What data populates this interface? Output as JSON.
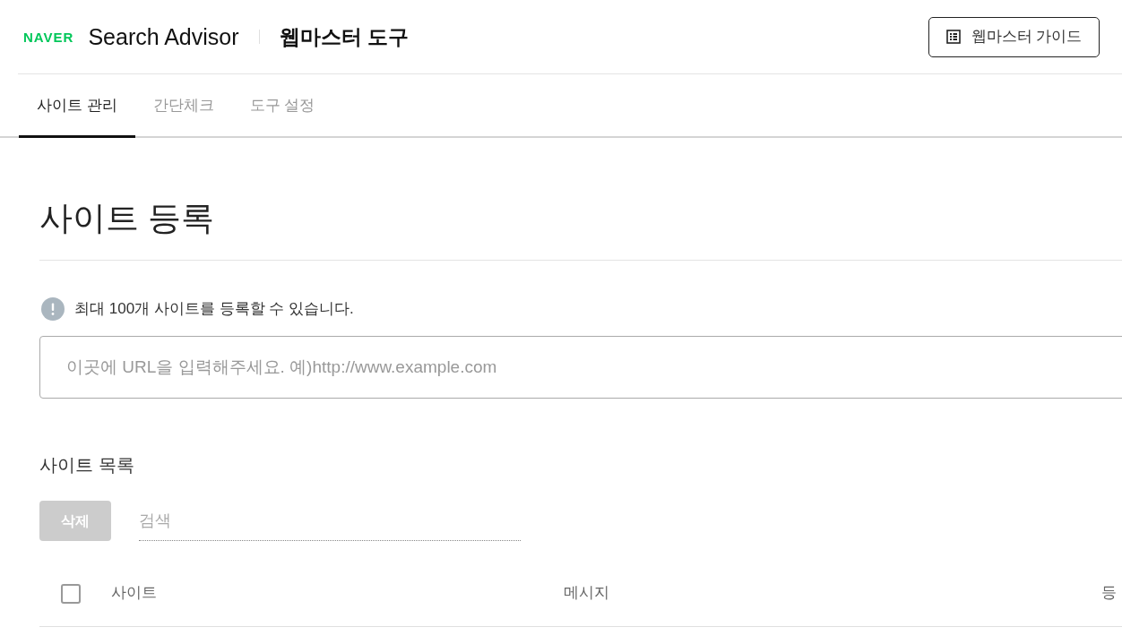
{
  "header": {
    "logo": "NAVER",
    "title": "Search Advisor",
    "subtitle": "웹마스터 도구",
    "guide_button": "웹마스터 가이드"
  },
  "tabs": [
    {
      "label": "사이트 관리",
      "selected": true
    },
    {
      "label": "간단체크",
      "selected": false
    },
    {
      "label": "도구 설정",
      "selected": false
    }
  ],
  "register": {
    "title": "사이트 등록",
    "notice": "최대 100개 사이트를 등록할 수 있습니다.",
    "url_input": {
      "placeholder": "이곳에 URL을 입력해주세요. 예)http://www.example.com"
    }
  },
  "site_list": {
    "title": "사이트 목록",
    "delete_button": {
      "label": "삭제",
      "disabled": true
    },
    "search": {
      "placeholder": "검색"
    },
    "table": {
      "select_all": {
        "checked": false
      },
      "columns": [
        "사이트",
        "메시지",
        "등"
      ]
    }
  }
}
